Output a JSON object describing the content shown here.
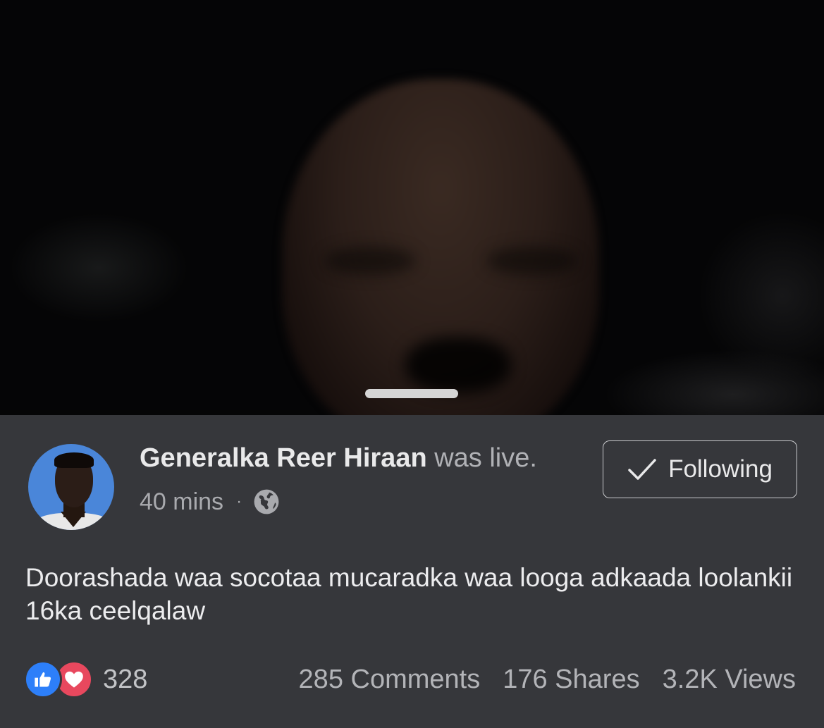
{
  "video": {
    "handle": "grab-handle"
  },
  "post": {
    "author_name": "Generalka Reer Hiraan",
    "author_status": " was live.",
    "time_ago": "40 mins",
    "separator": "·",
    "privacy_icon": "globe-icon",
    "follow_label": "Following",
    "follow_icon": "checkmark-icon",
    "caption": "Doorashada waa socotaa mucaradka waa looga adkaada loolankii 16ka ceelqalaw"
  },
  "engagement": {
    "reaction_icons": [
      "like-icon",
      "love-icon"
    ],
    "reaction_count": "328",
    "comments": "285 Comments",
    "shares": "176 Shares",
    "views": "3.2K Views"
  },
  "colors": {
    "background": "#36373b",
    "like": "#2d7ff9",
    "love": "#e8485e",
    "avatar_bg": "#4a86d9"
  }
}
